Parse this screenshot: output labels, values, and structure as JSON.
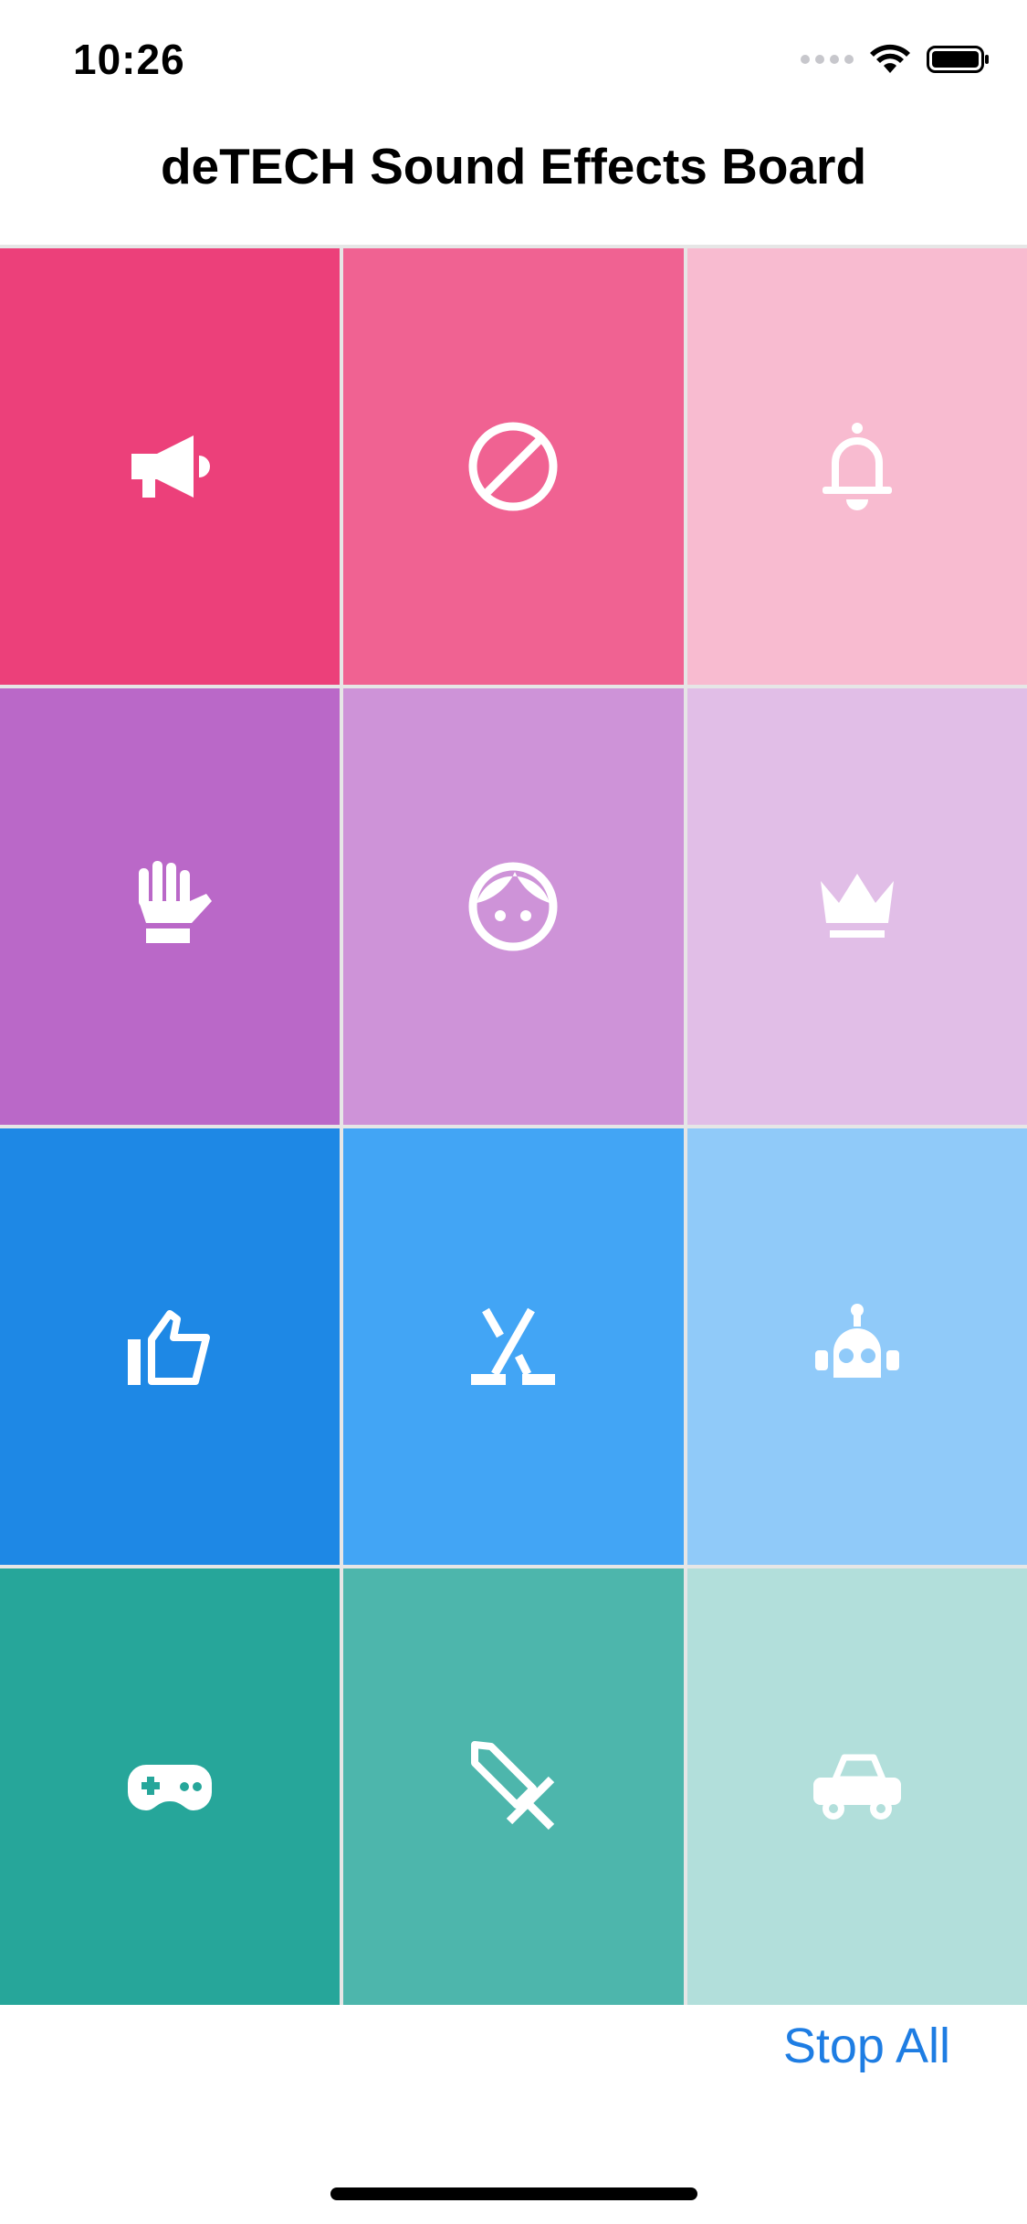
{
  "status": {
    "time": "10:26"
  },
  "nav": {
    "title": "deTECH Sound Effects Board"
  },
  "tiles": [
    {
      "icon": "megaphone-icon",
      "color": "#EC407A"
    },
    {
      "icon": "block-icon",
      "color": "#F06292"
    },
    {
      "icon": "bell-icon",
      "color": "#F8BBD0"
    },
    {
      "icon": "hand-icon",
      "color": "#BA68C8"
    },
    {
      "icon": "face-icon",
      "color": "#CE93D8"
    },
    {
      "icon": "crown-icon",
      "color": "#E1BEE7"
    },
    {
      "icon": "thumbs-up-icon",
      "color": "#1E88E5"
    },
    {
      "icon": "hockey-sticks-icon",
      "color": "#42A5F5"
    },
    {
      "icon": "robot-icon",
      "color": "#90CAF9"
    },
    {
      "icon": "gamepad-icon",
      "color": "#26A69A"
    },
    {
      "icon": "sword-icon",
      "color": "#4DB6AC"
    },
    {
      "icon": "car-icon",
      "color": "#B2DFDB"
    }
  ],
  "footer": {
    "stop_all_label": "Stop All"
  }
}
